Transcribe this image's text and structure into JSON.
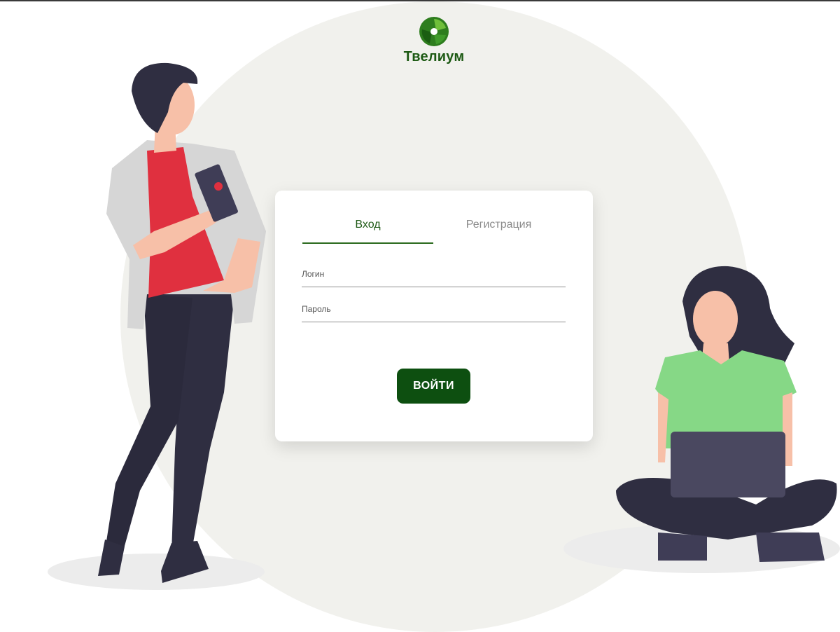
{
  "brand": {
    "name": "Твелиум",
    "logo_icon": "trefoil-logo-icon",
    "primary_color": "#1d5a14",
    "button_color": "#0d4f10"
  },
  "auth": {
    "tabs": [
      {
        "label": "Вход",
        "active": true
      },
      {
        "label": "Регистрация",
        "active": false
      }
    ],
    "fields": {
      "login": {
        "label": "Логин",
        "value": ""
      },
      "password": {
        "label": "Пароль",
        "value": ""
      }
    },
    "submit_label": "ВОЙТИ"
  },
  "illustrations": {
    "left": "standing-man-with-phone",
    "right": "sitting-woman-with-laptop"
  }
}
